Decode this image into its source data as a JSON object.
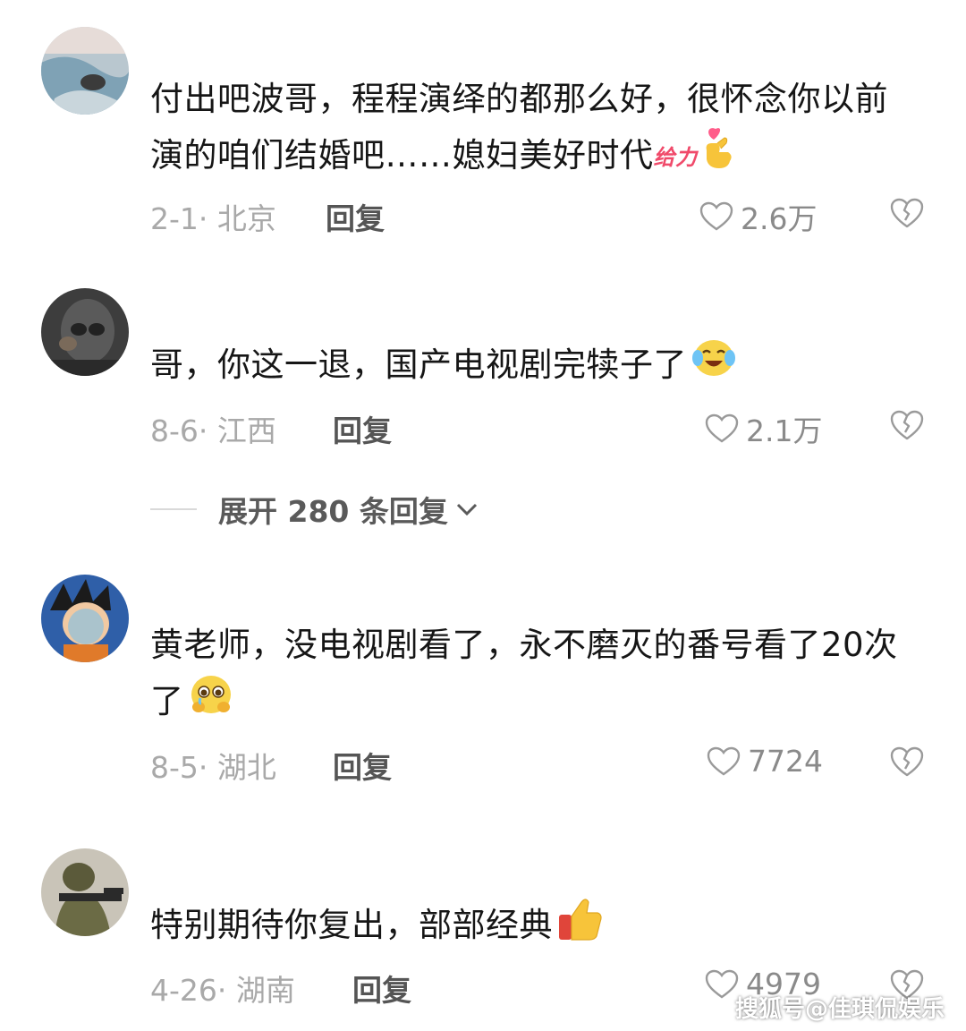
{
  "comments": [
    {
      "text": "付出吧波哥，程程演绎的都那么好，很怀念你以前演的咱们结婚吧……媳妇美好时代",
      "sticker": "给力",
      "emoji_icon": "finger-heart-icon",
      "meta": "2-1· 北京",
      "reply": "回复",
      "likes": "2.6万"
    },
    {
      "text": "哥，你这一退，国产电视剧完犊子了",
      "emoji_icon": "laughing-crying-face-icon",
      "meta": "8-6· 江西",
      "reply": "回复",
      "likes": "2.1万"
    },
    {
      "text": "黄老师，没电视剧看了，永不磨灭的番号看了20次了",
      "emoji_icon": "pleading-face-icon",
      "meta": "8-5· 湖北",
      "reply": "回复",
      "likes": "7724"
    },
    {
      "text": "特别期待你复出，部部经典",
      "emoji_icon": "thumbs-up-icon",
      "meta": "4-26· 湖南",
      "reply": "回复",
      "likes": "4979"
    }
  ],
  "expand_label": "展开 280 条回复",
  "watermark": "搜狐号@佳琪侃娱乐"
}
